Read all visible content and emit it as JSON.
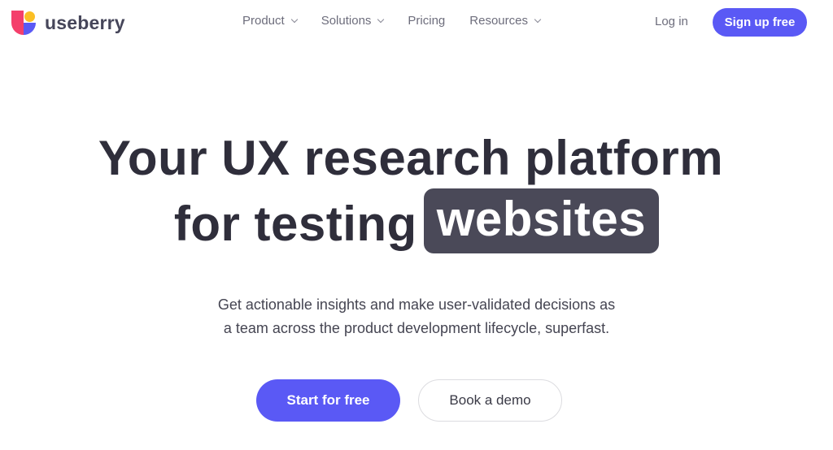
{
  "brand": {
    "name": "useberry",
    "logo_icon": "useberry-logo-icon",
    "colors": {
      "primary": "#5a59f5",
      "logo_red": "#f43f6b",
      "logo_yellow": "#fbbf24",
      "logo_blue": "#5a59f5",
      "highlight_bg": "#4a4958",
      "text_dark": "#2f2e3b"
    }
  },
  "nav": {
    "items": [
      {
        "label": "Product",
        "has_dropdown": true,
        "icon": "chevron-down-icon"
      },
      {
        "label": "Solutions",
        "has_dropdown": true,
        "icon": "chevron-down-icon"
      },
      {
        "label": "Pricing",
        "has_dropdown": false
      },
      {
        "label": "Resources",
        "has_dropdown": true,
        "icon": "chevron-down-icon"
      }
    ],
    "login_label": "Log in",
    "signup_label": "Sign up free"
  },
  "hero": {
    "title_line1": "Your UX research platform",
    "title_line2": "for testing",
    "title_highlight": "websites",
    "subtitle_line1": "Get actionable insights and make user-validated decisions as",
    "subtitle_line2": "a team across the product development lifecycle, superfast.",
    "primary_cta": "Start for free",
    "secondary_cta": "Book a demo"
  }
}
